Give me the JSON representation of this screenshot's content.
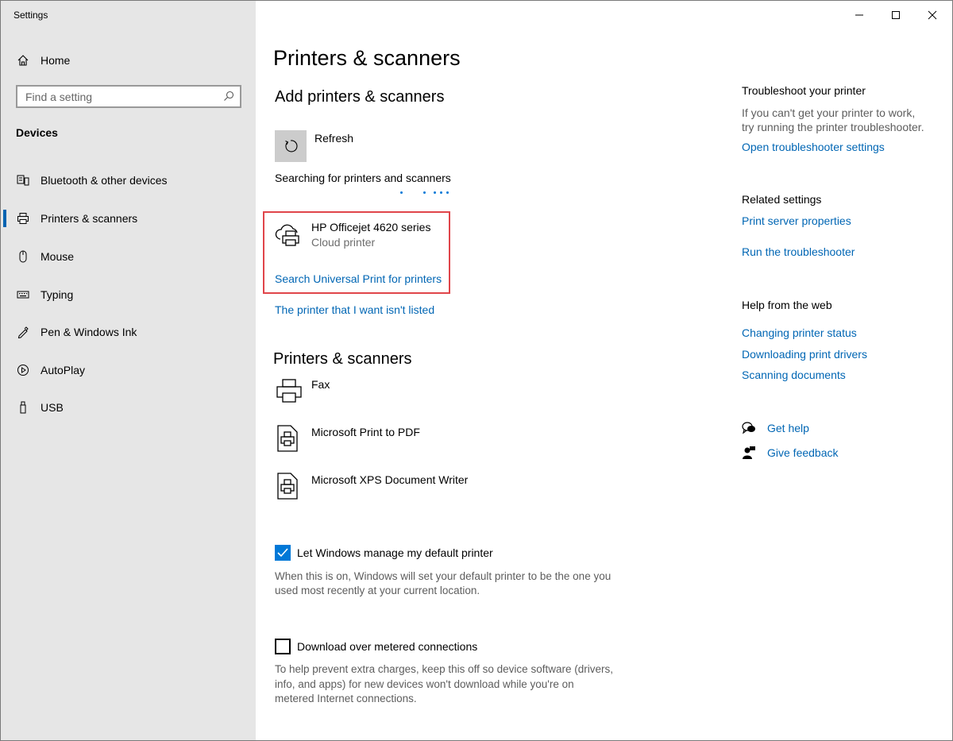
{
  "window": {
    "title": "Settings"
  },
  "sidebar": {
    "home_label": "Home",
    "search_placeholder": "Find a setting",
    "section": "Devices",
    "items": [
      {
        "label": "Bluetooth & other devices",
        "icon": "bluetooth-devices-icon"
      },
      {
        "label": "Printers & scanners",
        "icon": "printer-icon",
        "active": true
      },
      {
        "label": "Mouse",
        "icon": "mouse-icon"
      },
      {
        "label": "Typing",
        "icon": "keyboard-icon"
      },
      {
        "label": "Pen & Windows Ink",
        "icon": "pen-icon"
      },
      {
        "label": "AutoPlay",
        "icon": "autoplay-icon"
      },
      {
        "label": "USB",
        "icon": "usb-icon"
      }
    ]
  },
  "main": {
    "title": "Printers & scanners",
    "add_heading": "Add printers & scanners",
    "refresh_label": "Refresh",
    "searching_text": "Searching for printers and scanners",
    "found_printer": {
      "name": "HP Officejet 4620 series",
      "type": "Cloud printer"
    },
    "search_universal_link": "Search Universal Print for printers",
    "not_listed_link": "The printer that I want isn't listed",
    "list_heading": "Printers & scanners",
    "printers": [
      {
        "name": "Fax"
      },
      {
        "name": "Microsoft Print to PDF"
      },
      {
        "name": "Microsoft XPS Document Writer"
      }
    ],
    "default_printer": {
      "label": "Let Windows manage my default printer",
      "checked": true,
      "description_1": "When this is on, Windows will set your default printer to be the one you",
      "description_2": "used most recently at your current location."
    },
    "metered": {
      "label": "Download over metered connections",
      "checked": false,
      "description_1": "To help prevent extra charges, keep this off so device software (drivers,",
      "description_2": "info, and apps) for new devices won't download while you're on",
      "description_3": "metered Internet connections."
    }
  },
  "right": {
    "troubleshoot_title": "Troubleshoot your printer",
    "troubleshoot_desc_1": "If you can't get your printer to work,",
    "troubleshoot_desc_2": "try running the printer troubleshooter.",
    "troubleshoot_link": "Open troubleshooter settings",
    "related_title": "Related settings",
    "related_links": [
      "Print server properties",
      "Run the troubleshooter"
    ],
    "web_title": "Help from the web",
    "web_links": [
      "Changing printer status",
      "Downloading print drivers",
      "Scanning documents"
    ],
    "get_help": "Get help",
    "give_feedback": "Give feedback"
  },
  "colors": {
    "accent": "#0078d7",
    "link": "#0066b4",
    "highlight": "#e0454a",
    "sidebar_bg": "#e6e6e6"
  }
}
